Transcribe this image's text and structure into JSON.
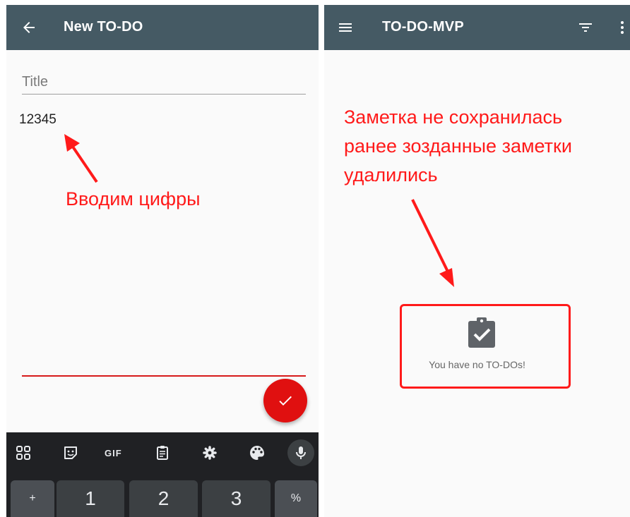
{
  "left_screen": {
    "app_bar": {
      "title": "New TO-DO",
      "back_icon": "arrow-back-icon"
    },
    "title_field": {
      "placeholder": "Title",
      "value": ""
    },
    "description_field": {
      "value": "12345"
    },
    "fab": {
      "icon": "check-icon"
    },
    "annotation": "Вводим цифры",
    "keyboard": {
      "toolbar": [
        "apps-grid-icon",
        "sticker-icon",
        "GIF",
        "clipboard-icon",
        "settings-icon",
        "palette-icon",
        "mic-icon"
      ],
      "gif_label": "GIF",
      "keys": [
        "+",
        "1",
        "2",
        "3",
        "%"
      ]
    }
  },
  "right_screen": {
    "app_bar": {
      "title": "TO-DO-MVP",
      "menu_icon": "menu-icon",
      "filter_icon": "filter-icon",
      "overflow_icon": "more-vert-icon"
    },
    "annotation_lines": [
      "Заметка не сохранилась",
      "ранее зозданные заметки",
      "удалились"
    ],
    "empty_state": {
      "icon": "clipboard-check-icon",
      "text": "You have no TO-DOs!"
    }
  },
  "colors": {
    "app_bar": "#455a64",
    "accent": "#e01010",
    "annotation": "#ff1a1a",
    "keyboard_bg": "#202124",
    "key_bg": "#3c4043"
  }
}
